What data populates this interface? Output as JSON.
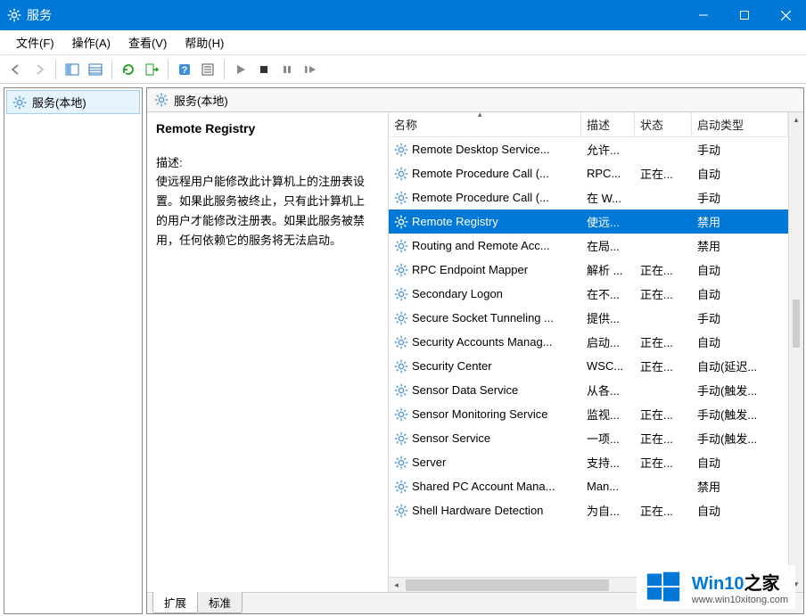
{
  "window": {
    "title": "服务"
  },
  "menus": {
    "file": "文件(F)",
    "action": "操作(A)",
    "view": "查看(V)",
    "help": "帮助(H)"
  },
  "tree": {
    "root": "服务(本地)"
  },
  "pane_header": "服务(本地)",
  "detail": {
    "name": "Remote Registry",
    "desc_label": "描述:",
    "desc_text": "使远程用户能修改此计算机上的注册表设置。如果此服务被终止，只有此计算机上的用户才能修改注册表。如果此服务被禁用，任何依赖它的服务将无法启动。"
  },
  "columns": {
    "name": "名称",
    "desc": "描述",
    "status": "状态",
    "start": "启动类型"
  },
  "services": [
    {
      "name": "Remote Desktop Service...",
      "desc": "允许...",
      "status": "",
      "start": "手动"
    },
    {
      "name": "Remote Procedure Call (...",
      "desc": "RPC...",
      "status": "正在...",
      "start": "自动"
    },
    {
      "name": "Remote Procedure Call (...",
      "desc": "在 W...",
      "status": "",
      "start": "手动"
    },
    {
      "name": "Remote Registry",
      "desc": "使远...",
      "status": "",
      "start": "禁用",
      "selected": true
    },
    {
      "name": "Routing and Remote Acc...",
      "desc": "在局...",
      "status": "",
      "start": "禁用"
    },
    {
      "name": "RPC Endpoint Mapper",
      "desc": "解析 ...",
      "status": "正在...",
      "start": "自动"
    },
    {
      "name": "Secondary Logon",
      "desc": "在不...",
      "status": "正在...",
      "start": "自动"
    },
    {
      "name": "Secure Socket Tunneling ...",
      "desc": "提供...",
      "status": "",
      "start": "手动"
    },
    {
      "name": "Security Accounts Manag...",
      "desc": "启动...",
      "status": "正在...",
      "start": "自动"
    },
    {
      "name": "Security Center",
      "desc": "WSC...",
      "status": "正在...",
      "start": "自动(延迟..."
    },
    {
      "name": "Sensor Data Service",
      "desc": "从各...",
      "status": "",
      "start": "手动(触发..."
    },
    {
      "name": "Sensor Monitoring Service",
      "desc": "监视...",
      "status": "正在...",
      "start": "手动(触发..."
    },
    {
      "name": "Sensor Service",
      "desc": "一项...",
      "status": "正在...",
      "start": "手动(触发..."
    },
    {
      "name": "Server",
      "desc": "支持...",
      "status": "正在...",
      "start": "自动"
    },
    {
      "name": "Shared PC Account Mana...",
      "desc": "Man...",
      "status": "",
      "start": "禁用"
    },
    {
      "name": "Shell Hardware Detection",
      "desc": "为自...",
      "status": "正在...",
      "start": "自动"
    }
  ],
  "tabs": {
    "extended": "扩展",
    "standard": "标准"
  },
  "watermark": {
    "brand_a": "Win10",
    "brand_b": "之家",
    "url": "www.win10xitong.com"
  }
}
